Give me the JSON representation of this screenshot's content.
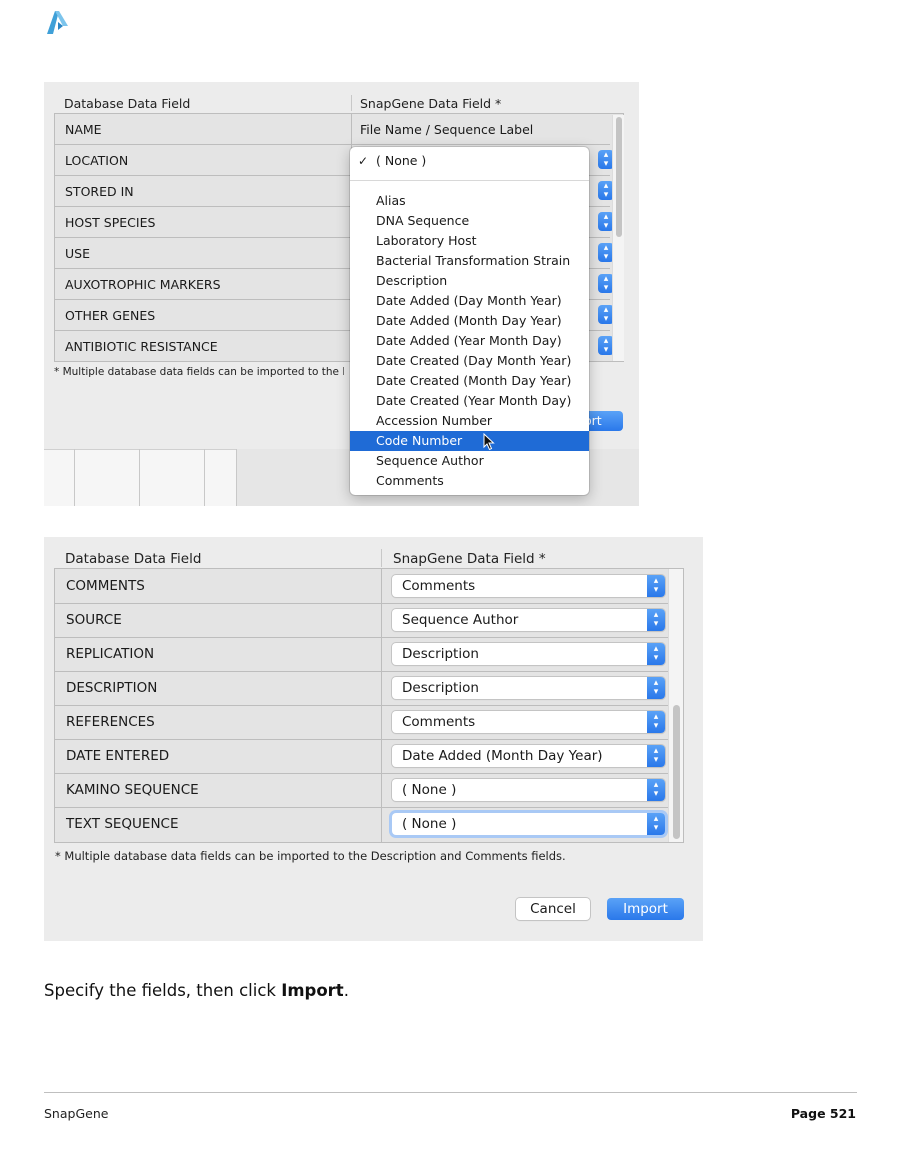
{
  "panel1": {
    "header_left": "Database Data Field",
    "header_right": "SnapGene Data Field *",
    "rows": [
      {
        "field": "NAME",
        "mapped": "File Name / Sequence Label"
      },
      {
        "field": "LOCATION",
        "mapped": ""
      },
      {
        "field": "STORED IN",
        "mapped": ""
      },
      {
        "field": "HOST SPECIES",
        "mapped": ""
      },
      {
        "field": "USE",
        "mapped": ""
      },
      {
        "field": "AUXOTROPHIC MARKERS",
        "mapped": ""
      },
      {
        "field": "OTHER GENES",
        "mapped": ""
      },
      {
        "field": "ANTIBIOTIC RESISTANCE",
        "mapped": ""
      }
    ],
    "note": "* Multiple database data fields can be imported to the De",
    "import_fragment": "ort",
    "dropdown": {
      "checked_item": "( None )",
      "items": [
        "Alias",
        "DNA Sequence",
        "Laboratory Host",
        "Bacterial Transformation Strain",
        "Description",
        "Date Added (Day Month Year)",
        "Date Added (Month Day Year)",
        "Date Added (Year Month Day)",
        "Date Created (Day Month Year)",
        "Date Created (Month Day Year)",
        "Date Created (Year Month Day)",
        "Accession Number",
        "Code Number",
        "Sequence Author",
        "Comments"
      ],
      "highlighted_item": "Code Number"
    }
  },
  "panel2": {
    "header_left": "Database Data Field",
    "header_right": "SnapGene Data Field *",
    "rows": [
      {
        "field": "COMMENTS",
        "mapped": "Comments"
      },
      {
        "field": "SOURCE",
        "mapped": "Sequence Author"
      },
      {
        "field": "REPLICATION",
        "mapped": "Description"
      },
      {
        "field": "DESCRIPTION",
        "mapped": "Description"
      },
      {
        "field": "REFERENCES",
        "mapped": "Comments"
      },
      {
        "field": "DATE ENTERED",
        "mapped": "Date Added (Month Day Year)"
      },
      {
        "field": "KAMINO SEQUENCE",
        "mapped": "( None )"
      },
      {
        "field": "TEXT SEQUENCE",
        "mapped": "( None )"
      }
    ],
    "note": "* Multiple database data fields can be imported to the Description and Comments fields.",
    "cancel_label": "Cancel",
    "import_label": "Import"
  },
  "instruction": {
    "prefix": "Specify the fields, then click ",
    "bold": "Import",
    "suffix": "."
  },
  "footer": {
    "left": "SnapGene",
    "right": "Page 521"
  },
  "colors": {
    "accent_blue": "#2a78ea",
    "selection_blue": "#1f6bd6",
    "panel_bg": "#ececec"
  }
}
